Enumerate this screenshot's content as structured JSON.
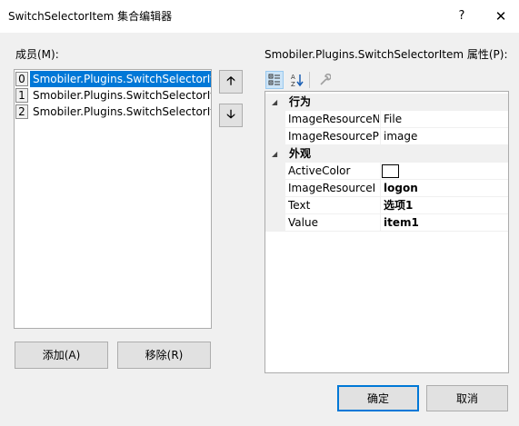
{
  "window": {
    "title": "SwitchSelectorItem 集合编辑器",
    "help_glyph": "?",
    "close_glyph": "✕"
  },
  "members": {
    "label": "成员(M):",
    "items": [
      {
        "index": "0",
        "text": "Smobiler.Plugins.SwitchSelectorIt",
        "selected": true
      },
      {
        "index": "1",
        "text": "Smobiler.Plugins.SwitchSelectorIt",
        "selected": false
      },
      {
        "index": "2",
        "text": "Smobiler.Plugins.SwitchSelectorIt",
        "selected": false
      }
    ],
    "move_up_icon": "arrow-up-icon",
    "move_down_icon": "arrow-down-icon",
    "add_label": "添加(A)",
    "remove_label": "移除(R)"
  },
  "properties": {
    "label": "Smobiler.Plugins.SwitchSelectorItem 属性(P):",
    "toolbar": {
      "categorized_icon": "categorized-icon",
      "alphabetical_icon": "alphabetical-sort-icon",
      "property_pages_icon": "wrench-icon"
    },
    "categories": [
      {
        "name": "行为",
        "rows": [
          {
            "name": "ImageResourceN",
            "value": "File"
          },
          {
            "name": "ImageResourceP",
            "value": "image"
          }
        ]
      },
      {
        "name": "外观",
        "rows": [
          {
            "name": "ActiveColor",
            "value": "",
            "swatch": "#ffffff"
          },
          {
            "name": "ImageResourceI",
            "value": "logon",
            "bold": true
          },
          {
            "name": "Text",
            "value": "选项1",
            "bold": true
          },
          {
            "name": "Value",
            "value": "item1",
            "bold": true
          }
        ]
      }
    ]
  },
  "footer": {
    "ok_label": "确定",
    "cancel_label": "取消"
  },
  "colors": {
    "selection": "#0078d7",
    "dialog_bg": "#f0f0f0"
  }
}
